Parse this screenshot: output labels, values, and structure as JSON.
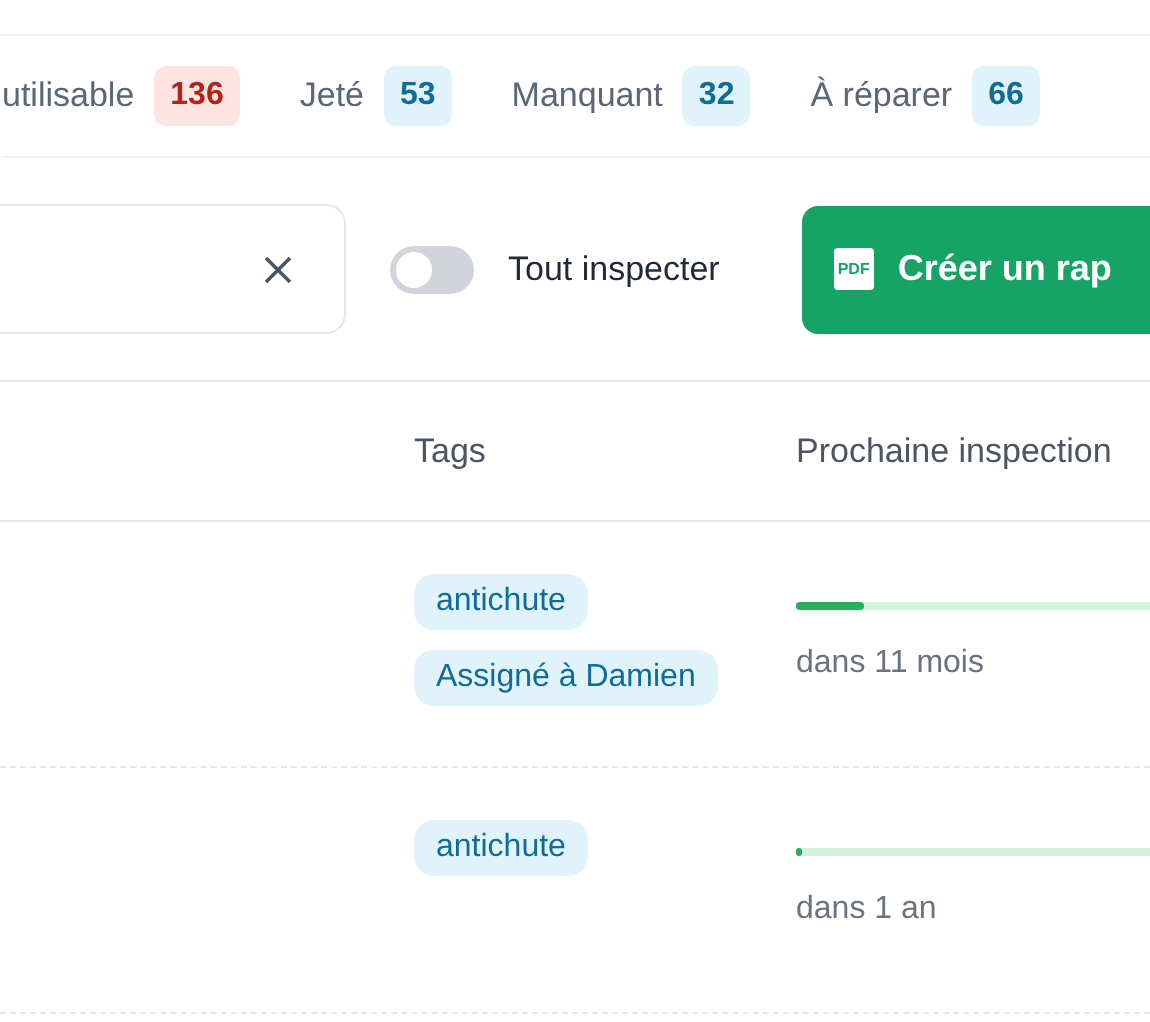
{
  "tabs": [
    {
      "label": "utilisable",
      "count": "136",
      "color": "#b42318",
      "selected": false
    },
    {
      "label": "Jeté",
      "count": "53",
      "color": "#0e6c96",
      "selected": false
    },
    {
      "label": "Manquant",
      "count": "32",
      "color": "#0e6c96",
      "selected": false
    },
    {
      "label": "À réparer",
      "count": "66",
      "color": "#0e6c96",
      "selected": false
    }
  ],
  "toolbar": {
    "toggle": {
      "label": "Tout inspecter",
      "on": false
    },
    "button": "Créer un rap",
    "button_icon": "PDF"
  },
  "table": {
    "columns": [
      "Tags",
      "Prochaine inspection"
    ],
    "rows": [
      {
        "tags": [
          "antichute",
          "Assigné à Damien"
        ],
        "level": 0.13,
        "next": "dans 11 mois"
      },
      {
        "tags": [
          "antichute"
        ],
        "level": 0.01,
        "next": "dans 1 an"
      }
    ]
  }
}
